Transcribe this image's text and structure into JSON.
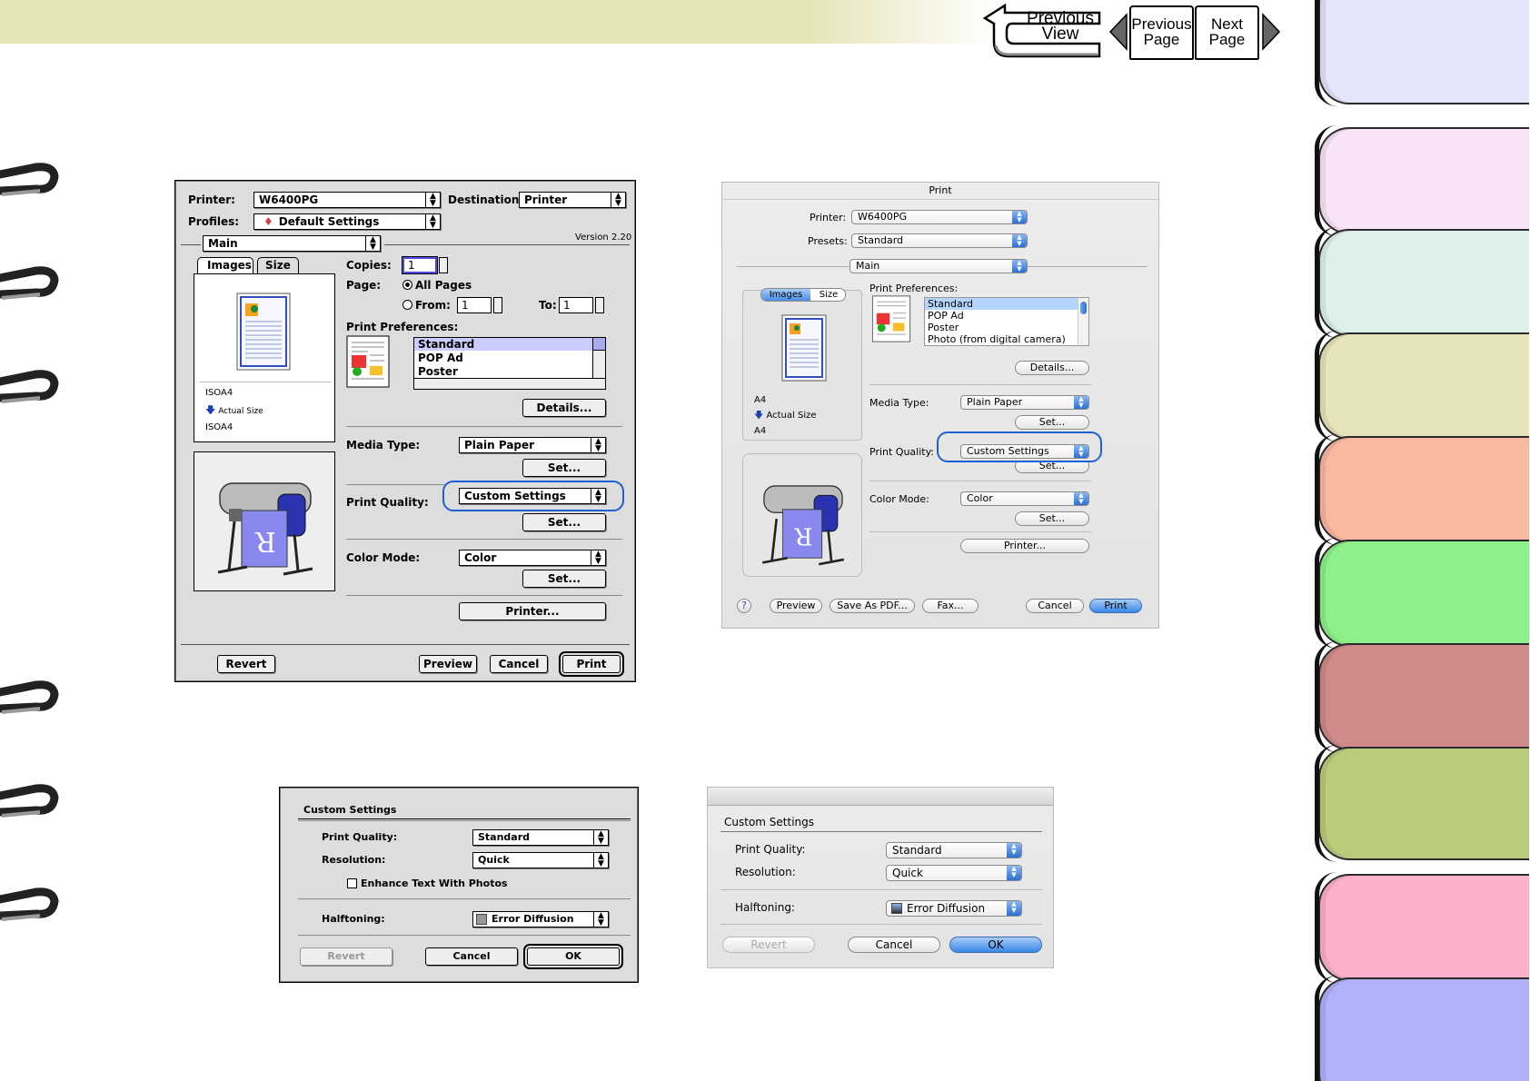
{
  "nav": {
    "previous_view": "Previous View",
    "previous_page": "Previous Page",
    "next_page": "Next Page"
  },
  "classic_print": {
    "printer_label": "Printer:",
    "printer_value": "W6400PG",
    "destination_label": "Destination:",
    "destination_value": "Printer",
    "profiles_label": "Profiles:",
    "profiles_value": "Default Settings",
    "panel_value": "Main",
    "version": "Version 2.20",
    "tab_images": "Images",
    "tab_size": "Size",
    "copies_label": "Copies:",
    "copies_value": "1",
    "page_label": "Page:",
    "all_pages": "All Pages",
    "from_label": "From:",
    "from_value": "1",
    "to_label": "To:",
    "to_value": "1",
    "prefs_label": "Print Preferences:",
    "prefs_items": [
      "Standard",
      "POP Ad",
      "Poster"
    ],
    "details_button": "Details...",
    "media_label": "Media Type:",
    "media_value": "Plain Paper",
    "set_button": "Set...",
    "quality_label": "Print Quality:",
    "quality_value": "Custom Settings",
    "color_label": "Color Mode:",
    "color_value": "Color",
    "printer_button": "Printer...",
    "paper1": "ISOA4",
    "actual_size": "Actual Size",
    "paper2": "ISOA4",
    "revert": "Revert",
    "preview": "Preview",
    "cancel": "Cancel",
    "print": "Print"
  },
  "aqua_print": {
    "title": "Print",
    "printer_label": "Printer:",
    "printer_value": "W6400PG",
    "presets_label": "Presets:",
    "presets_value": "Standard",
    "panel_value": "Main",
    "tab_images": "Images",
    "tab_size": "Size",
    "prefs_label": "Print Preferences:",
    "prefs_items": [
      "Standard",
      "POP Ad",
      "Poster",
      "Photo (from digital camera)"
    ],
    "details_button": "Details...",
    "media_label": "Media Type:",
    "media_value": "Plain Paper",
    "set_button": "Set...",
    "quality_label": "Print Quality:",
    "quality_value": "Custom Settings",
    "color_label": "Color Mode:",
    "color_value": "Color",
    "printer_button": "Printer...",
    "paper1": "A4",
    "actual_size": "Actual Size",
    "paper2": "A4",
    "help": "?",
    "preview": "Preview",
    "save_pdf": "Save As PDF...",
    "fax": "Fax...",
    "cancel": "Cancel",
    "print": "Print"
  },
  "classic_custom": {
    "title": "Custom Settings",
    "quality_label": "Print Quality:",
    "quality_value": "Standard",
    "resolution_label": "Resolution:",
    "resolution_value": "Quick",
    "enhance_label": "Enhance Text With Photos",
    "halftoning_label": "Halftoning:",
    "halftoning_value": "Error Diffusion",
    "revert": "Revert",
    "cancel": "Cancel",
    "ok": "OK"
  },
  "aqua_custom": {
    "title": "Custom Settings",
    "quality_label": "Print Quality:",
    "quality_value": "Standard",
    "resolution_label": "Resolution:",
    "resolution_value": "Quick",
    "halftoning_label": "Halftoning:",
    "halftoning_value": "Error Diffusion",
    "revert": "Revert",
    "cancel": "Cancel",
    "ok": "OK"
  },
  "colors": {
    "top_band": "#e6e3b4",
    "highlight": "#1f5fd6",
    "tabs": [
      "#e4e4fb",
      "#f9e4f7",
      "#dff0ec",
      "#e6e4b8",
      "#fbb8a0",
      "#8ef08a",
      "#d08a8a",
      "#b8cc7a",
      "#fcb0cc",
      "#b0b0fb"
    ]
  }
}
